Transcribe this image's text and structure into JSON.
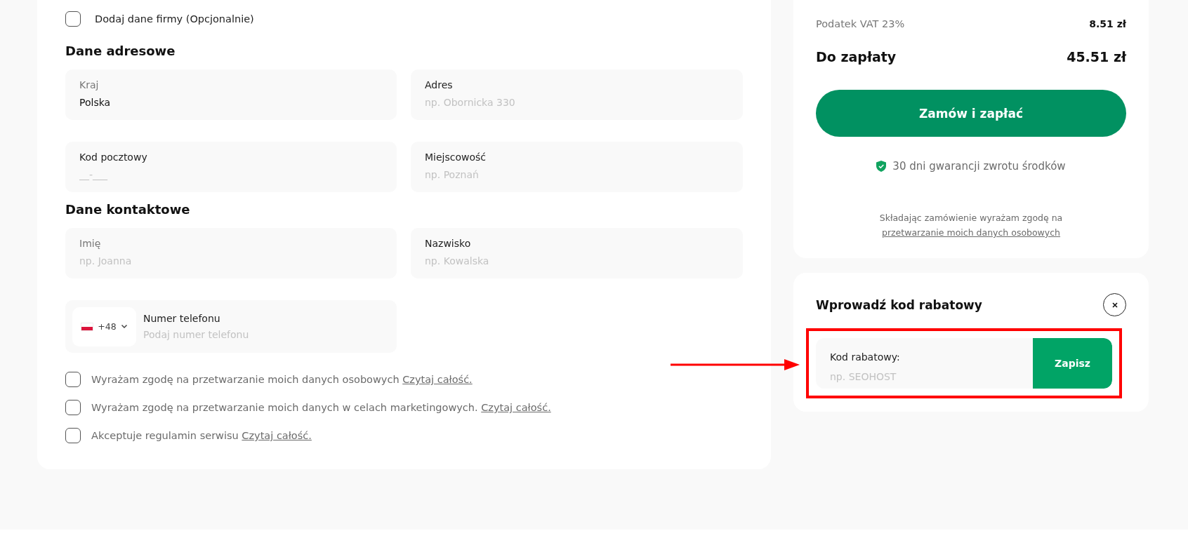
{
  "company_toggle": {
    "label": "Dodaj dane firmy (Opcjonalnie)",
    "checked": false
  },
  "address_section": {
    "title": "Dane adresowe",
    "fields": [
      {
        "label": "Kraj",
        "value": "Polska"
      },
      {
        "label": "Adres",
        "placeholder": "np. Obornicka 330"
      },
      {
        "label": "Kod pocztowy",
        "placeholder": "__-___"
      },
      {
        "label": "Miejscowość",
        "placeholder": "np. Poznań"
      }
    ]
  },
  "contact_section": {
    "title": "Dane kontaktowe",
    "fields": [
      {
        "label": "Imię",
        "placeholder": "np. Joanna"
      },
      {
        "label": "Nazwisko",
        "placeholder": "np. Kowalska"
      }
    ],
    "phone": {
      "country_code": "+48",
      "label": "Numer telefonu",
      "placeholder": "Podaj numer telefonu"
    }
  },
  "consents": [
    {
      "text": "Wyrażam zgodę na przetwarzanie moich danych osobowych",
      "link": "Czytaj całość.",
      "checked": false
    },
    {
      "text": "Wyrażam zgodę na przetwarzanie moich danych w celach marketingowych.",
      "link": "Czytaj całość.",
      "checked": false
    },
    {
      "text": "Akceptuje regulamin serwisu",
      "link": "Czytaj całość.",
      "checked": false
    }
  ],
  "summary": {
    "vat_label": "Podatek VAT 23%",
    "vat_value": "8.51 zł",
    "total_label": "Do zapłaty",
    "total_value": "45.51 zł",
    "order_button": "Zamów i zapłać",
    "guarantee": "30 dni gwarancji zwrotu środków",
    "terms_text": "Składając zamówienie wyrażam zgodę na",
    "terms_link": "przetwarzanie moich danych osobowych"
  },
  "discount": {
    "title": "Wprowadź kod rabatowy",
    "field_label": "Kod rabatowy:",
    "placeholder": "np. SEOHOST",
    "save_button": "Zapisz"
  }
}
